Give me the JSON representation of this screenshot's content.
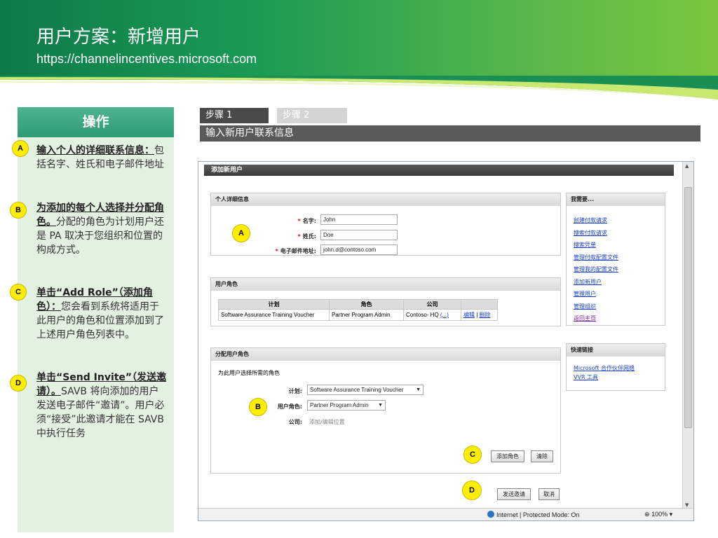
{
  "slide": {
    "title": "用户方案：新增用户",
    "url": "https://channelincentives.microsoft.com"
  },
  "actions": {
    "heading": "操作",
    "items": [
      {
        "badge": "A",
        "lead": "输入个人的详细联系信息：",
        "text": "包括名字、姓氏和电子邮件地址"
      },
      {
        "badge": "B",
        "lead": "为添加的每个人选择并分配角色。",
        "text": "分配的角色为计划用户还是 PA 取决于您组织和位置的构成方式。"
      },
      {
        "badge": "C",
        "lead": "单击“Add Role”（添加角色）：",
        "text": "您会看到系统将适用于此用户的角色和位置添加到了上述用户角色列表中。"
      },
      {
        "badge": "D",
        "lead": "单击“Send Invite”（发送邀请）。",
        "text": "SAVB 将向添加的用户发送电子邮件“邀请”。用户必须“接受”此邀请才能在 SAVB 中执行任务"
      }
    ]
  },
  "steps": {
    "step1": "步骤 1",
    "step2": "步骤 2",
    "bar": "输入新用户联系信息"
  },
  "browser": {
    "page_title": "添加新用户",
    "personal": {
      "heading": "个人详细信息",
      "badge": "A",
      "first_name_label": "名字:",
      "first_name_value": "John",
      "last_name_label": "姓氏:",
      "last_name_value": "Doe",
      "email_label": "电子邮件地址:",
      "email_value": "john.d@contoso.com"
    },
    "roles": {
      "heading": "用户角色",
      "columns": [
        "计划",
        "角色",
        "公司",
        ""
      ],
      "rows": [
        {
          "plan": "Software Assurance Training Voucher",
          "role": "Partner Program Admin",
          "company": "Contoso- HQ",
          "more": "(...)",
          "edit": "编辑",
          "sep": "|",
          "delete": "删除"
        }
      ]
    },
    "assign": {
      "heading": "分配用户角色",
      "instruction": "为此用户选择所需的角色",
      "badge": "B",
      "plan_label": "计划:",
      "plan_value": "Software Assurance Training Voucher",
      "role_label": "用户角色:",
      "role_value": "Partner Program Admin",
      "company_label": "公司:",
      "company_value": "添加/编辑位置",
      "badge_c": "C",
      "add_role": "添加角色",
      "clear": "清除"
    },
    "footer": {
      "badge": "D",
      "send_invite": "发送邀请",
      "cancel": "取消"
    },
    "ineed": {
      "heading": "我需要...",
      "links": [
        "创建付款请求",
        "搜索付款请求",
        "搜索凭单",
        "管理付款配置文件",
        "管理我的配置文件",
        "添加新用户",
        "管理用户",
        "管理组织",
        "返回主页"
      ]
    },
    "quicklinks": {
      "heading": "快速链接",
      "links": [
        "Microsoft 合作伙伴网络",
        "VVR 工具"
      ]
    },
    "status": {
      "zone": "Internet | Protected Mode: On",
      "zoom": "100%"
    }
  }
}
